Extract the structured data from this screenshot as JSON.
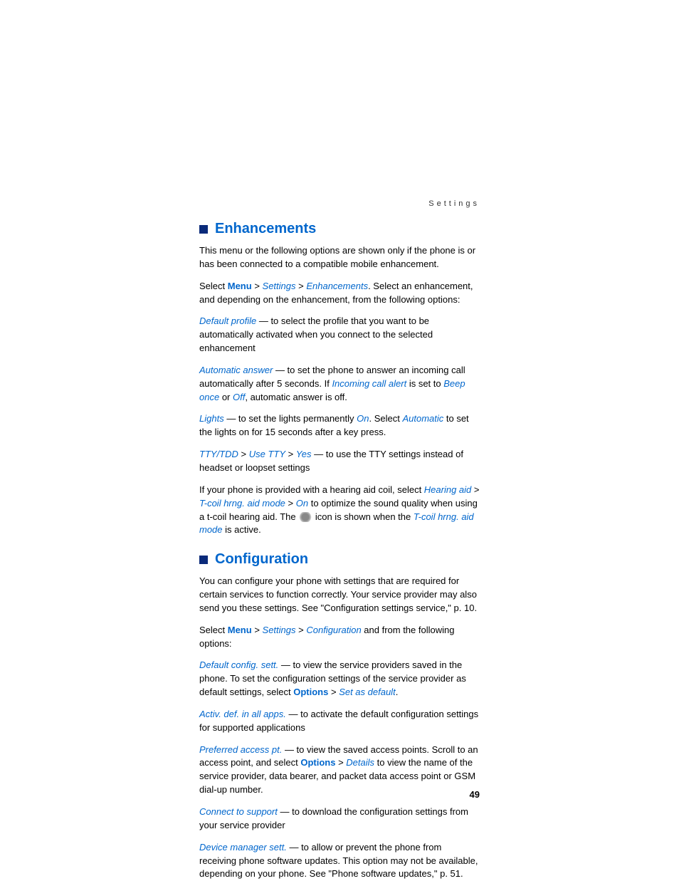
{
  "header": "Settings",
  "pageNumber": "49",
  "sec1": {
    "title": "Enhancements",
    "p1": "This menu or the following options are shown only if the phone is or has been connected to a compatible mobile enhancement.",
    "p2a": "Select ",
    "menu": "Menu",
    "gt": " > ",
    "settings": "Settings",
    "enhancements": "Enhancements",
    "p2b": ". Select an enhancement, and depending on the enhancement, from the following options:",
    "defaultProfile": "Default profile",
    "p3": " — to select the profile that you want to be automatically activated when you connect to the selected enhancement",
    "autoAnswer": "Automatic answer",
    "p4a": " — to set the phone to answer an incoming call automatically after 5 seconds. If ",
    "incomingCallAlert": "Incoming call alert",
    "p4b": " is set to ",
    "beepOnce": "Beep once",
    "p4c": " or ",
    "off": "Off",
    "p4d": ", automatic answer is off.",
    "lights": "Lights",
    "p5a": " — to set the lights permanently ",
    "on": "On",
    "p5b": ". Select ",
    "automatic": "Automatic",
    "p5c": " to set the lights on for 15 seconds after a key press.",
    "tty": "TTY/TDD",
    "useTty": "Use TTY",
    "yes": "Yes",
    "p6": " — to use the TTY settings instead of headset or loopset settings",
    "p7a": "If your phone is provided with a hearing aid coil, select ",
    "hearingAid": "Hearing aid",
    "tcoil": "T-coil hrng. aid mode",
    "p7b": " to optimize the sound quality when using a t-coil hearing aid. The ",
    "p7c": " icon is shown when the ",
    "tcoil2": "T-coil hrng. aid mode",
    "p7d": " is active."
  },
  "sec2": {
    "title": "Configuration",
    "p1": "You can configure your phone with settings that are required for certain services to function correctly. Your service provider may also send you these settings. See \"Configuration settings service,\" p. 10.",
    "p2a": "Select ",
    "menu": "Menu",
    "gt": " > ",
    "settings": "Settings",
    "configuration": "Configuration",
    "p2b": " and from the following options:",
    "defaultConfig": "Default config. sett.",
    "p3a": " — to view the service providers saved in the phone. To set the configuration settings of the service provider as default settings, select ",
    "options": "Options",
    "setAsDefault": "Set as default",
    "p3b": ".",
    "activDef": "Activ. def. in all apps.",
    "p4": " — to activate the default configuration settings for supported applications",
    "prefAccess": "Preferred access pt.",
    "p5a": " — to view the saved access points. Scroll to an access point, and select ",
    "details": "Details",
    "p5b": " to view the name of the service provider, data bearer, and packet data access point or GSM dial-up number.",
    "connectSupport": "Connect to support",
    "p6": " — to download the configuration settings from your service provider",
    "deviceMgr": "Device manager sett.",
    "p7": " — to allow or prevent the phone from receiving phone software updates. This option may not be available, depending on your phone. See \"Phone software updates,\" p. 51."
  }
}
